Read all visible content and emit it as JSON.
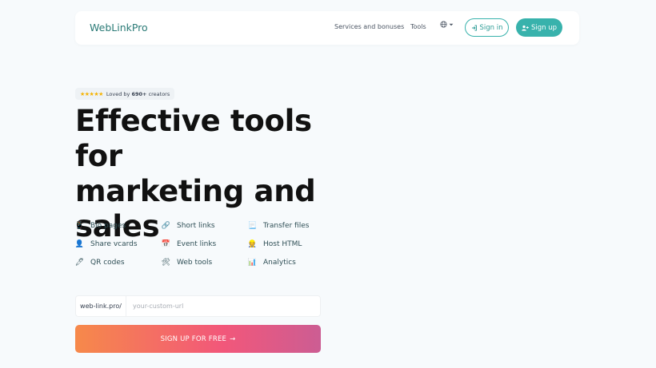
{
  "header": {
    "brand": "WebLinkPro",
    "nav": [
      "Services and bonuses",
      "Tools"
    ],
    "lang_icon": "globe-icon",
    "signin_label": "Sign in",
    "signup_label": "Sign up"
  },
  "badge": {
    "stars": "★★★★★",
    "prefix": "Loved by",
    "count": "690+",
    "suffix": "creators"
  },
  "hero": {
    "line1": "Effective tools for",
    "line2": "marketing and",
    "line3": "sales"
  },
  "features": [
    {
      "icon": "📱",
      "icon_name": "phone-icon",
      "label": "Bio pages"
    },
    {
      "icon": "🔗",
      "icon_name": "link-icon",
      "label": "Short links"
    },
    {
      "icon": "📃",
      "icon_name": "document-icon",
      "label": "Transfer files"
    },
    {
      "icon": "👤",
      "icon_name": "person-icon",
      "label": "Share vcards"
    },
    {
      "icon": "📅",
      "icon_name": "calendar-icon",
      "label": "Event links"
    },
    {
      "icon": "👷",
      "icon_name": "worker-icon",
      "label": "Host HTML"
    },
    {
      "icon": "🖊",
      "icon_name": "pen-icon",
      "label": "QR codes"
    },
    {
      "icon": "🛠",
      "icon_name": "tools-icon",
      "label": "Web tools"
    },
    {
      "icon": "📊",
      "icon_name": "chart-icon",
      "label": "Analytics"
    }
  ],
  "signup_form": {
    "prefix": "web-link.pro/",
    "placeholder": "your-custom-url",
    "value": "",
    "cta_label": "SIGN UP FOR FREE",
    "cta_arrow": "→"
  },
  "colors": {
    "accent": "#38b2ac",
    "brand_text": "#2a7a76",
    "cta_gradient_start": "#f6894a",
    "cta_gradient_end": "#cc5d93"
  }
}
